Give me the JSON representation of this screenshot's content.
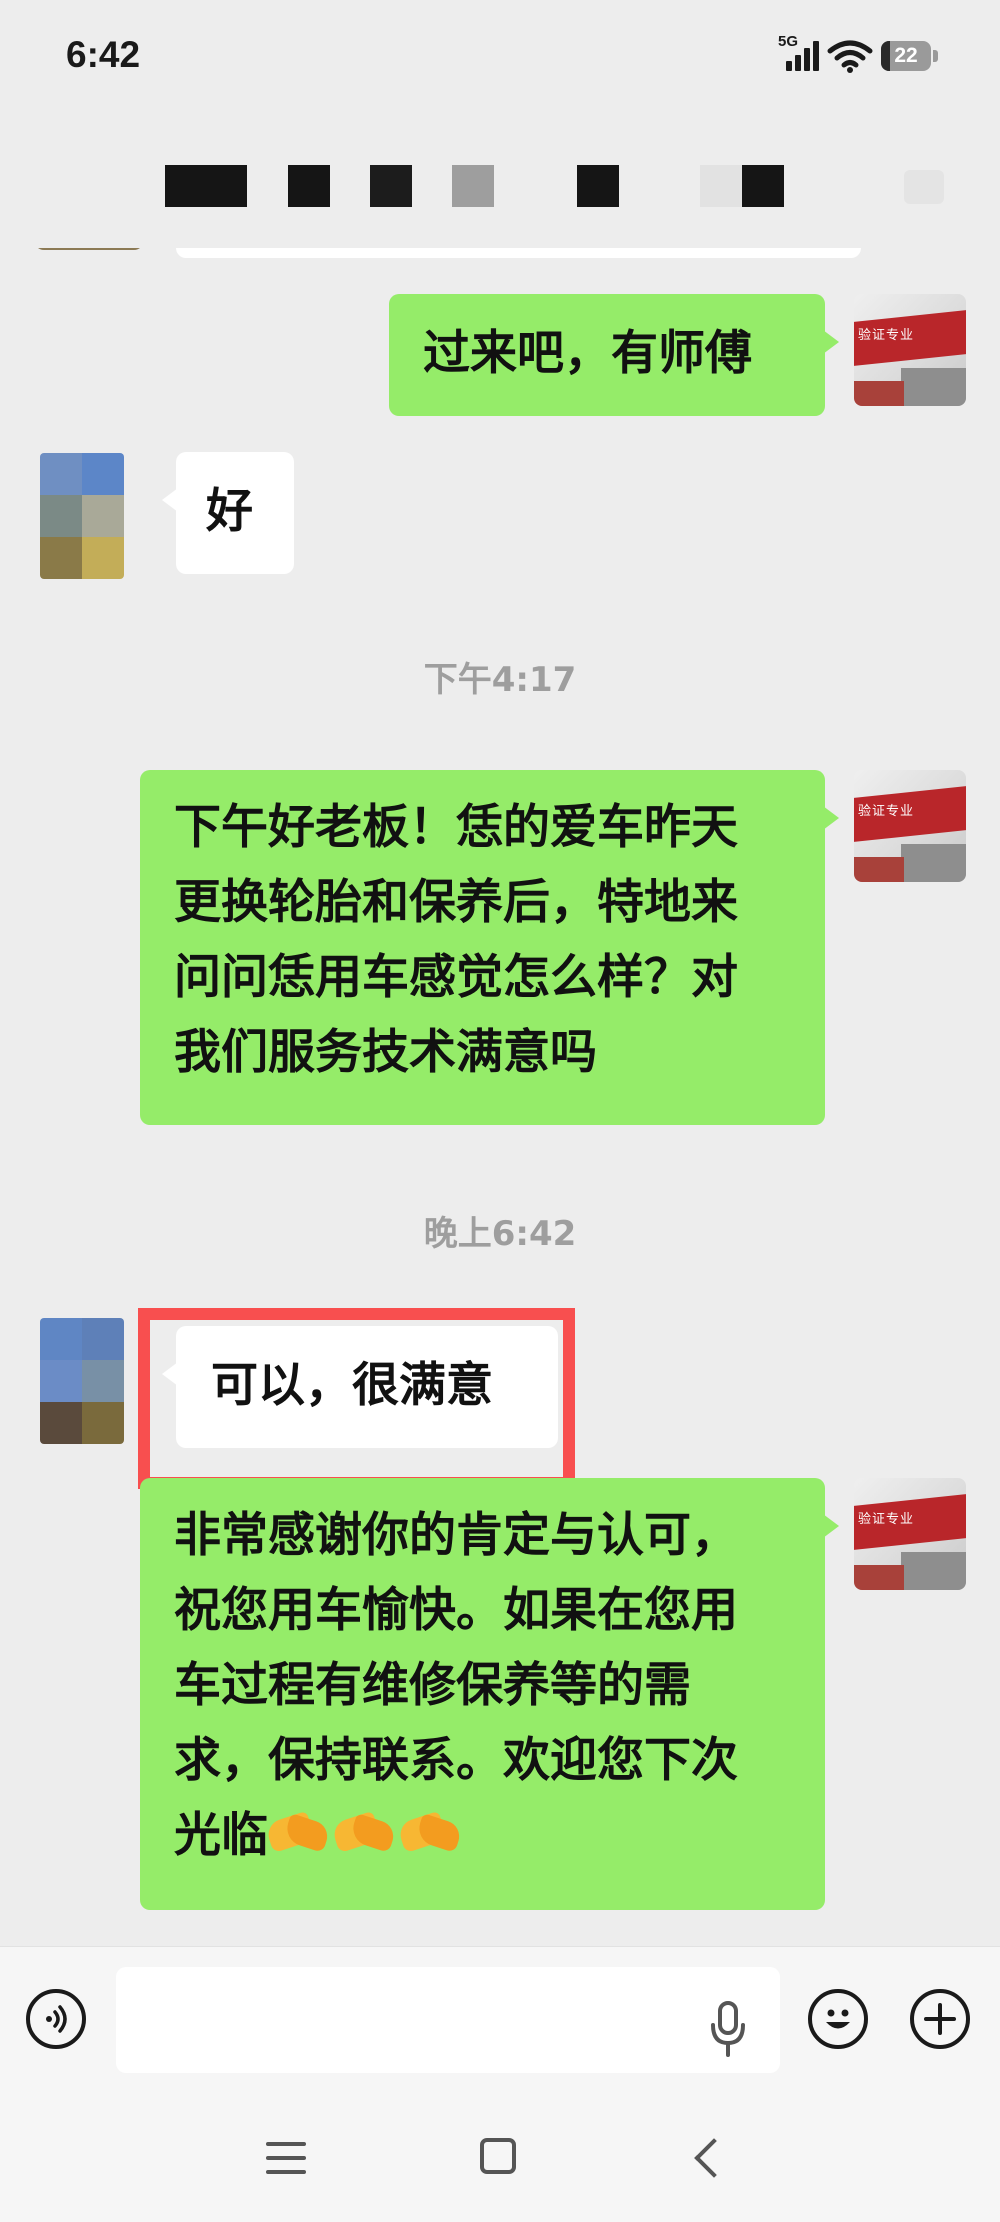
{
  "status_bar": {
    "time": "6:42",
    "network": "5G",
    "battery": "22"
  },
  "header": {
    "title_redacted": true
  },
  "messages": [
    {
      "sender": "me",
      "text": "过来吧，有师傅"
    },
    {
      "sender": "contact",
      "text": "好"
    },
    {
      "type": "timestamp",
      "text": "下午4:17"
    },
    {
      "sender": "me",
      "lines": [
        "下午好老板！恁的爱车昨天",
        "更换轮胎和保养后，特地来",
        "问问恁用车感觉怎么样？对",
        "我们服务技术满意吗"
      ]
    },
    {
      "type": "timestamp",
      "text": "晚上6:42"
    },
    {
      "sender": "contact",
      "text": "可以，很满意",
      "highlighted": true
    },
    {
      "sender": "me",
      "lines": [
        "非常感谢你的肯定与认可，",
        "祝您用车愉快。如果在您用",
        "车过程有维修保养等的需",
        "求，保持联系。欢迎您下次",
        "光临"
      ],
      "emoji": [
        "handshake",
        "handshake",
        "handshake"
      ]
    }
  ],
  "input_bar": {
    "placeholder": "",
    "icons": [
      "voice-icon",
      "mic-icon",
      "emoji-icon",
      "plus-icon"
    ]
  },
  "colors": {
    "background": "#ededed",
    "my_bubble": "#95ec69",
    "their_bubble": "#ffffff",
    "highlight": "#f84f4f"
  }
}
